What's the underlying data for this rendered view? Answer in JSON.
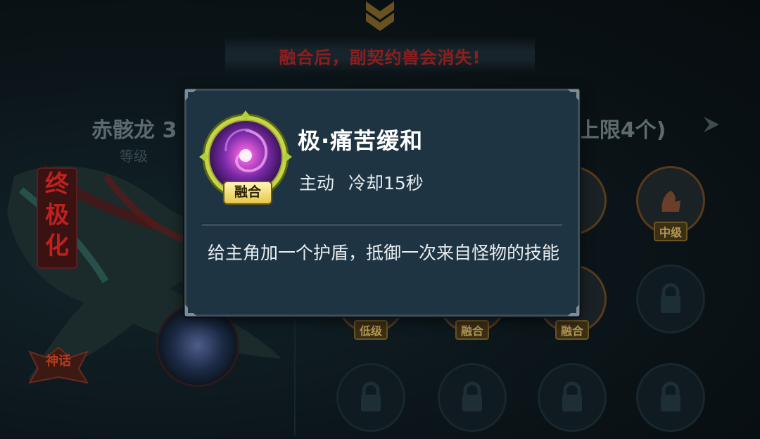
{
  "warning": "融合后，副契约兽会消失!",
  "background": {
    "pet_name_partial": "赤骸龙 3",
    "level_label_partial": "等级",
    "limit_text": "(上限4个)",
    "vertical_title": [
      "终",
      "极",
      "化"
    ],
    "myth_badge": "神话",
    "slot_labels": {
      "mid": "中级",
      "low": "低级",
      "fusion_a": "融合",
      "fusion_b": "融合"
    }
  },
  "popup": {
    "skill_name": "极·痛苦缓和",
    "fusion_tag": "融合",
    "skill_type": "主动",
    "cooldown": "冷却15秒",
    "description": "给主角加一个护盾，抵御一次来自怪物的技能"
  },
  "colors": {
    "popup_bg": "#1f3442",
    "warning_red": "#8e1e1e",
    "skill_glow": "#a23bd4"
  },
  "icons": [
    "chevron-down-icon",
    "lock-icon",
    "vortex-skill-icon",
    "arrow-right-icon"
  ]
}
